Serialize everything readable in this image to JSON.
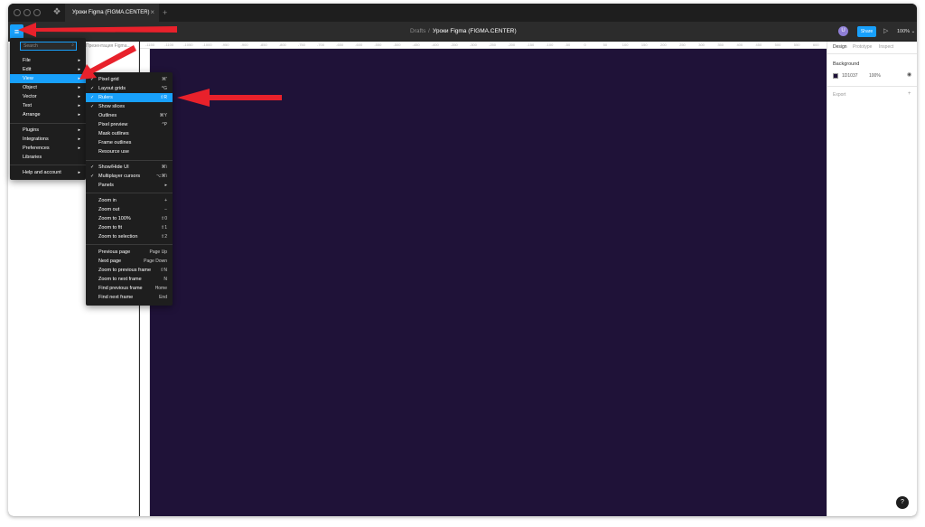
{
  "tab": {
    "title": "Уроки Figma (FIGMA.CENTER)",
    "close": "×",
    "add": "+"
  },
  "toolbar": {
    "menu_icon": "≡",
    "breadcrumb_project": "Drafts",
    "breadcrumb_sep": "/",
    "file_name": "Уроки Figma (FIGMA.CENTER)",
    "file_chevron": "⌄",
    "avatar_letter": "U",
    "share_label": "Share",
    "play_icon": "▷",
    "zoom_label": "100% ⌄"
  },
  "left_panel": {
    "page_label": "Презентация Figma..."
  },
  "ruler_top_ticks": [
    "-1150",
    "-1100",
    "-1050",
    "-1000",
    "-950",
    "-900",
    "-850",
    "-800",
    "-750",
    "-700",
    "-650",
    "-600",
    "-550",
    "-500",
    "-450",
    "-400",
    "-350",
    "-300",
    "-250",
    "-200",
    "-150",
    "-100",
    "-50",
    "0",
    "50",
    "100",
    "150",
    "200",
    "250",
    "300",
    "350",
    "400",
    "450",
    "500",
    "550",
    "600"
  ],
  "right_panel": {
    "tabs": [
      "Design",
      "Prototype",
      "Inspect"
    ],
    "background_title": "Background",
    "hex": "1D1037",
    "opacity": "100%",
    "eye_icon": "◉",
    "export_label": "Export",
    "export_plus": "+"
  },
  "main_menu": {
    "search_placeholder": "Search",
    "search_icon": "⌕",
    "items": [
      {
        "label": "File",
        "arrow": "▸"
      },
      {
        "label": "Edit",
        "arrow": "▸"
      },
      {
        "label": "View",
        "arrow": "▸"
      },
      {
        "label": "Object",
        "arrow": "▸"
      },
      {
        "label": "Vector",
        "arrow": "▸"
      },
      {
        "label": "Text",
        "arrow": "▸"
      },
      {
        "label": "Arrange",
        "arrow": "▸"
      },
      {
        "label": "Plugins",
        "arrow": "▸"
      },
      {
        "label": "Integrations",
        "arrow": "▸"
      },
      {
        "label": "Preferences",
        "arrow": "▸"
      },
      {
        "label": "Libraries",
        "arrow": ""
      },
      {
        "label": "Help and account",
        "arrow": "▸"
      }
    ]
  },
  "view_menu": {
    "items": [
      {
        "label": "Pixel grid",
        "check": "✓",
        "shortcut": "⌘'"
      },
      {
        "label": "Layout grids",
        "check": "✓",
        "shortcut": "^G"
      },
      {
        "label": "Rulers",
        "check": "✓",
        "shortcut": "⇧R"
      },
      {
        "label": "Show slices",
        "check": "✓",
        "shortcut": ""
      },
      {
        "label": "Outlines",
        "check": "",
        "shortcut": "⌘Y"
      },
      {
        "label": "Pixel preview",
        "check": "",
        "shortcut": "^P"
      },
      {
        "label": "Mask outlines",
        "check": "",
        "shortcut": ""
      },
      {
        "label": "Frame outlines",
        "check": "",
        "shortcut": ""
      },
      {
        "label": "Resource use",
        "check": "",
        "shortcut": ""
      },
      {
        "label": "Show/Hide UI",
        "check": "✓",
        "shortcut": "⌘\\"
      },
      {
        "label": "Multiplayer cursors",
        "check": "✓",
        "shortcut": "⌥⌘\\"
      },
      {
        "label": "Panels",
        "check": "",
        "shortcut": "▸"
      },
      {
        "label": "Zoom in",
        "check": "",
        "shortcut": "+"
      },
      {
        "label": "Zoom out",
        "check": "",
        "shortcut": "−"
      },
      {
        "label": "Zoom to 100%",
        "check": "",
        "shortcut": "⇧0"
      },
      {
        "label": "Zoom to fit",
        "check": "",
        "shortcut": "⇧1"
      },
      {
        "label": "Zoom to selection",
        "check": "",
        "shortcut": "⇧2"
      },
      {
        "label": "Previous page",
        "check": "",
        "shortcut": "Page Up"
      },
      {
        "label": "Next page",
        "check": "",
        "shortcut": "Page Down"
      },
      {
        "label": "Zoom to previous frame",
        "check": "",
        "shortcut": "⇧N"
      },
      {
        "label": "Zoom to next frame",
        "check": "",
        "shortcut": "N"
      },
      {
        "label": "Find previous frame",
        "check": "",
        "shortcut": "Home"
      },
      {
        "label": "Find next frame",
        "check": "",
        "shortcut": "End"
      }
    ]
  },
  "help_label": "?",
  "colors": {
    "accent": "#18a0fb",
    "frame": "#1f1238",
    "annotation": "#e8212b"
  }
}
